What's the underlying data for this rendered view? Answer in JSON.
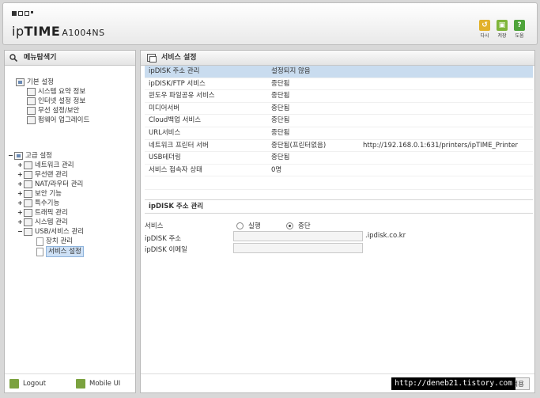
{
  "header": {
    "brand_pre": "ip",
    "brand_bold": "TIME",
    "model": "A1004NS",
    "buttons": [
      {
        "label": "다시",
        "icon": "refresh-icon",
        "color": "#e2b12a"
      },
      {
        "label": "저장",
        "icon": "save-icon",
        "color": "#7fb53a"
      },
      {
        "label": "도움",
        "icon": "help-icon",
        "color": "#4ea33a"
      }
    ]
  },
  "left_panel": {
    "title": "메뉴탐색기",
    "basic": {
      "label": "기본 설정",
      "items": [
        "시스템 요약 정보",
        "인터넷 설정 정보",
        "무선 설정/보안",
        "펌웨어 업그레이드"
      ]
    },
    "advanced": {
      "label": "고급 설정",
      "items": [
        "네트워크 관리",
        "무선랜 관리",
        "NAT/라우터 관리",
        "보안 기능",
        "특수기능",
        "트래픽 관리",
        "시스템 관리",
        "USB/서비스 관리"
      ],
      "usb_children": [
        "장치 관리",
        "서비스 설정"
      ]
    },
    "footer": {
      "logout": "Logout",
      "mobile": "Mobile UI"
    }
  },
  "right_panel": {
    "title": "서비스 설정",
    "services": [
      {
        "name": "ipDISK 주소 관리",
        "status": "설정되지 않음",
        "extra": ""
      },
      {
        "name": "ipDISK/FTP 서비스",
        "status": "중단됨",
        "extra": ""
      },
      {
        "name": "윈도우 파일공유 서비스",
        "status": "중단됨",
        "extra": ""
      },
      {
        "name": "미디어서버",
        "status": "중단됨",
        "extra": ""
      },
      {
        "name": "Cloud백업 서비스",
        "status": "중단됨",
        "extra": ""
      },
      {
        "name": "URL서비스",
        "status": "중단됨",
        "extra": ""
      },
      {
        "name": "네트워크 프린터 서버",
        "status": "중단됨(프린터없음)",
        "extra": "http://192.168.0.1:631/printers/ipTIME_Printer"
      },
      {
        "name": "USB테더링",
        "status": "중단됨",
        "extra": ""
      },
      {
        "name": "서비스 접속자 상태",
        "status": "0명",
        "extra": ""
      }
    ],
    "ipdisk": {
      "title": "ipDISK 주소 관리",
      "service_label": "서비스",
      "run_label": "실행",
      "stop_label": "중단",
      "selected": "중단",
      "address_label": "ipDISK 주소",
      "address_value": "",
      "address_suffix": ".ipdisk.co.kr",
      "email_label": "ipDISK 이메일",
      "email_value": ""
    },
    "apply_label": "적용",
    "watermark": "http://deneb21.tistory.com"
  }
}
